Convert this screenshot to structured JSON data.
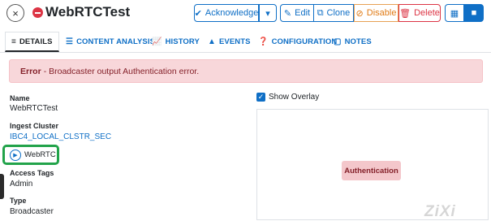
{
  "header": {
    "title": "WebRTCTest",
    "close_icon": "×",
    "buttons": {
      "acknowledge": "Acknowledge",
      "edit": "Edit",
      "clone": "Clone",
      "disable": "Disable",
      "delete": "Delete"
    }
  },
  "tabs": [
    {
      "label": "DETAILS",
      "icon": "list-icon"
    },
    {
      "label": "CONTENT ANALYSIS",
      "icon": "sliders-icon"
    },
    {
      "label": "HISTORY",
      "icon": "chart-icon"
    },
    {
      "label": "EVENTS",
      "icon": "warning-icon"
    },
    {
      "label": "CONFIGURATION",
      "icon": "question-icon"
    },
    {
      "label": "NOTES",
      "icon": "note-icon"
    }
  ],
  "alert": {
    "prefix": "Error",
    "message": "- Broadcaster output Authentication error."
  },
  "details": {
    "name_label": "Name",
    "name_value": "WebRTCTest",
    "cluster_label": "Ingest Cluster",
    "cluster_value": "IBC4_LOCAL_CLSTR_SEC",
    "preview_label": "WebRTC",
    "tags_label": "Access Tags",
    "tags_value": "Admin",
    "type_label": "Type",
    "type_value": "Broadcaster"
  },
  "overlay": {
    "label": "Show Overlay",
    "checked": true,
    "status": "Authentication"
  },
  "watermark": "ZiXi",
  "colors": {
    "accent": "#0f6fc6",
    "danger": "#dc3545",
    "warning": "#e07a14",
    "highlight": "#22a34a"
  }
}
